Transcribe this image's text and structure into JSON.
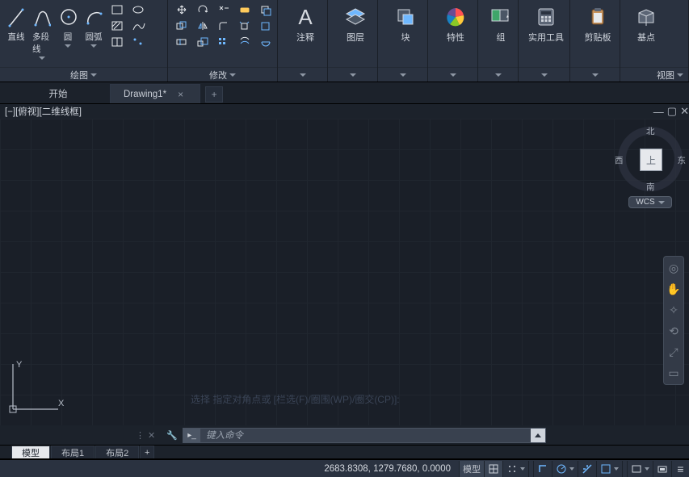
{
  "ribbon": {
    "draw": {
      "title": "绘图",
      "btns": [
        {
          "label": "直线"
        },
        {
          "label": "多段线"
        },
        {
          "label": "圆"
        },
        {
          "label": "圆弧"
        }
      ]
    },
    "mod": {
      "title": "修改"
    },
    "panels": [
      {
        "label": "注释"
      },
      {
        "label": "图层"
      },
      {
        "label": "块"
      },
      {
        "label": "特性"
      },
      {
        "label": "组"
      },
      {
        "label": "实用工具"
      },
      {
        "label": "剪贴板"
      },
      {
        "label": "基点"
      }
    ],
    "view": {
      "title": "视图"
    }
  },
  "tabs": {
    "start": "开始",
    "doc": "Drawing1*"
  },
  "viewlabel": "[−][俯视][二维线框]",
  "viewcube": {
    "n": "北",
    "s": "南",
    "e": "东",
    "w": "西",
    "top": "上",
    "wcs": "WCS"
  },
  "ucs": {
    "y": "Y",
    "x": "X"
  },
  "ghost": "选择 指定对角点或 [栏选(F)/圈围(WP)/圈交(CP)]:",
  "cmd": {
    "placeholder": "键入命令"
  },
  "layouts": {
    "model": "模型",
    "l1": "布局1",
    "l2": "布局2",
    "plus": "+"
  },
  "status": {
    "coord": "2683.8308, 1279.7680, 0.0000",
    "model": "模型"
  }
}
